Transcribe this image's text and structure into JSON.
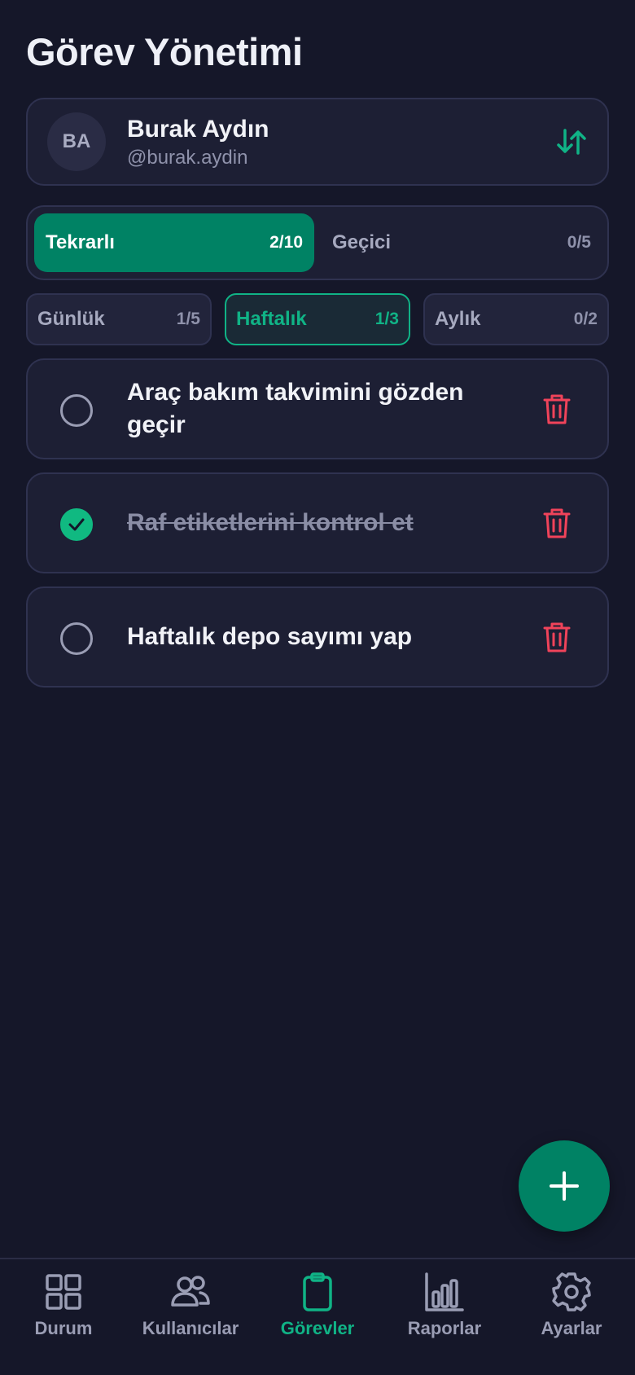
{
  "page": {
    "title": "Görev Yönetimi"
  },
  "user": {
    "initials": "BA",
    "name": "Burak Aydın",
    "handle": "@burak.aydin"
  },
  "segments": [
    {
      "label": "Tekrarlı",
      "count": "2/10",
      "active": true
    },
    {
      "label": "Geçici",
      "count": "0/5",
      "active": false
    }
  ],
  "periods": [
    {
      "label": "Günlük",
      "count": "1/5",
      "active": false
    },
    {
      "label": "Haftalık",
      "count": "1/3",
      "active": true
    },
    {
      "label": "Aylık",
      "count": "0/2",
      "active": false
    }
  ],
  "tasks": [
    {
      "text": "Araç bakım takvimini gözden geçir",
      "done": false
    },
    {
      "text": "Raf etiketlerini kontrol et",
      "done": true
    },
    {
      "text": "Haftalık depo sayımı yap",
      "done": false
    }
  ],
  "nav": [
    {
      "label": "Durum",
      "icon": "grid-icon",
      "active": false
    },
    {
      "label": "Kullanıcılar",
      "icon": "users-icon",
      "active": false
    },
    {
      "label": "Görevler",
      "icon": "clipboard-icon",
      "active": true
    },
    {
      "label": "Raporlar",
      "icon": "bar-chart-icon",
      "active": false
    },
    {
      "label": "Ayarlar",
      "icon": "gear-icon",
      "active": false
    }
  ],
  "colors": {
    "accent": "#008264",
    "accent_text": "#10b386",
    "danger": "#f0435a",
    "background": "#151729",
    "card": "#1d1f34"
  }
}
